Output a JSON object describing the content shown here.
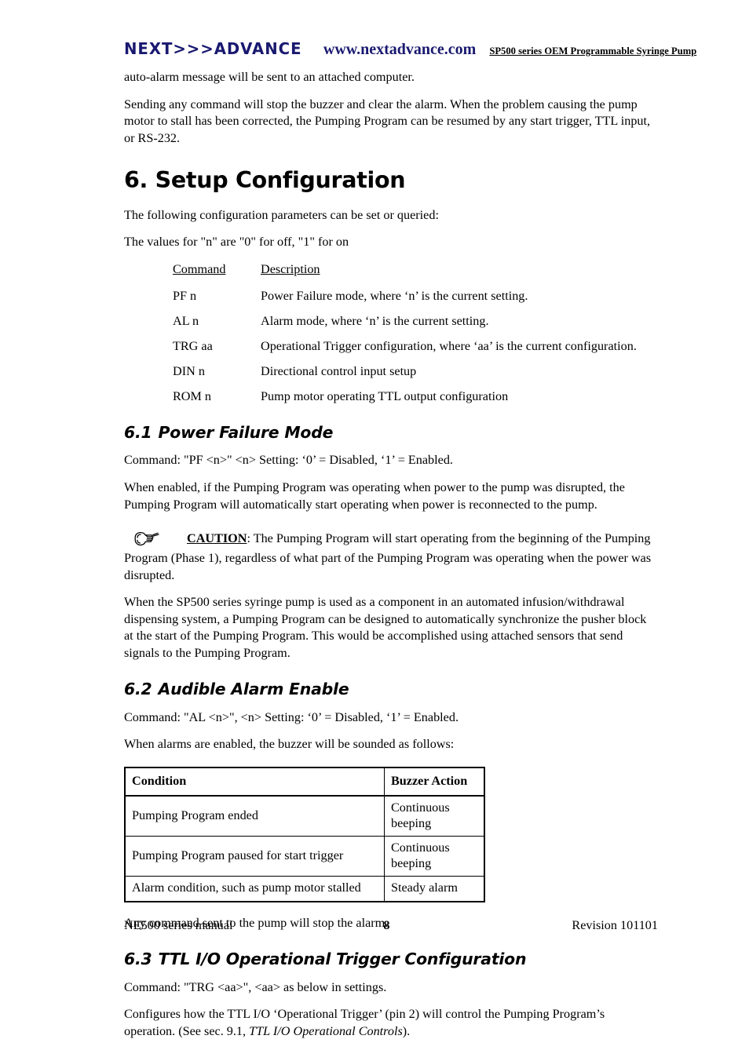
{
  "header": {
    "logo": "NEXT>>>ADVANCE",
    "url": "www.nextadvance.com",
    "tagline": "SP500 series OEM Programmable Syringe Pump",
    "logo_color": "#191970",
    "url_color": "#191970"
  },
  "intro": {
    "para1": "auto-alarm message will be sent to an attached computer.",
    "para2": "Sending any command will stop the buzzer and clear the alarm.  When the problem causing the pump motor to stall has been corrected, the Pumping Program can be resumed by any start trigger, TTL input, or RS-232."
  },
  "chapter": {
    "title": "6.  Setup Configuration",
    "lead1": "The following configuration parameters can be set or queried:",
    "lead2": "The values for \"n\" are \"0\" for off, \"1\" for on"
  },
  "command_table": {
    "header": {
      "command": "Command",
      "description": "Description"
    },
    "rows": [
      {
        "command": "PF n",
        "description": "Power Failure mode, where ‘n’ is the current setting."
      },
      {
        "command": "AL n",
        "description": "Alarm mode, where ‘n’ is the current setting."
      },
      {
        "command": "TRG aa",
        "description": "Operational Trigger configuration, where ‘aa’ is the current configuration."
      },
      {
        "command": "DIN n",
        "description": "Directional control input setup"
      },
      {
        "command": "ROM n",
        "description": "Pump motor operating TTL output configuration"
      }
    ]
  },
  "section_61": {
    "number": "6.1",
    "title": "Power Failure Mode",
    "command_line": "Command:  \"PF <n>\"  <n> Setting:  ‘0’ = Disabled, ‘1’ = Enabled.",
    "para1": "When enabled, if the Pumping Program was operating when power to the pump was disrupted, the Pumping Program will automatically start operating when power is reconnected to the pump.",
    "caution": {
      "icon": "pointing-hand-icon",
      "label": "CAUTION",
      "first_line": ":  The Pumping Program will start operating from the beginning of the Pumping",
      "rest": "Program (Phase 1), regardless of what part of the Pumping Program was operating when the power was disrupted."
    },
    "para2": "When the SP500 series syringe pump is used as a component in an automated infusion/withdrawal dispensing system, a Pumping Program can be designed to automatically synchronize the pusher block at the start of the Pumping Program.  This would be accomplished using attached sensors that send signals to the Pumping Program."
  },
  "section_62": {
    "number": "6.2",
    "title": "Audible Alarm Enable",
    "command_line": "Command: \"AL <n>\",  <n> Setting:  ‘0’ = Disabled, ‘1’ = Enabled.",
    "para1": "When alarms are enabled, the buzzer will be sounded as follows:",
    "buzzer_table": {
      "columns": [
        "Condition",
        "Buzzer Action"
      ],
      "rows": [
        [
          "Pumping Program ended",
          "Continuous beeping"
        ],
        [
          "Pumping Program paused for start trigger",
          "Continuous beeping"
        ],
        [
          "Alarm condition, such as pump motor stalled",
          "Steady alarm"
        ]
      ]
    },
    "para2": "Any command sent to the pump will stop the alarm."
  },
  "section_63": {
    "number": "6.3",
    "title": "TTL I/O Operational Trigger Configuration",
    "command_line": "Command:  \"TRG <aa>\",  <aa> as below in settings.",
    "para_start": "Configures how the TTL I/O ‘Operational Trigger’ (pin 2) will control the Pumping Program’s operation. (See sec. 9.1, ",
    "para_italic": "TTL I/O Operational Controls",
    "para_end": ")."
  },
  "footer": {
    "left": "NE500 series manual",
    "page": "8",
    "right": "Revision 101101"
  }
}
